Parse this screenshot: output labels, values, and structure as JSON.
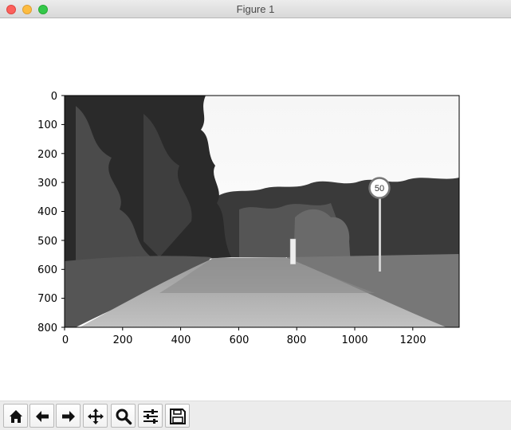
{
  "window": {
    "title": "Figure 1",
    "controls": [
      "close",
      "minimize",
      "maximize"
    ]
  },
  "axes": {
    "x_ticks": [
      "0",
      "200",
      "400",
      "600",
      "800",
      "1000",
      "1200"
    ],
    "y_ticks": [
      "0",
      "100",
      "200",
      "300",
      "400",
      "500",
      "600",
      "700",
      "800"
    ],
    "image_content": "grayscale photo",
    "sign_text": "50"
  },
  "toolbar": {
    "buttons": [
      {
        "name": "home-button",
        "icon": "home-icon"
      },
      {
        "name": "back-button",
        "icon": "arrow-left-icon"
      },
      {
        "name": "forward-button",
        "icon": "arrow-right-icon"
      },
      {
        "name": "pan-button",
        "icon": "move-icon"
      },
      {
        "name": "zoom-button",
        "icon": "magnifier-icon"
      },
      {
        "name": "configure-subplots-button",
        "icon": "sliders-icon"
      },
      {
        "name": "save-button",
        "icon": "floppy-disk-icon"
      }
    ]
  },
  "colors": {
    "titlebar": "#dedede",
    "toolbar": "#ececec",
    "close": "#fc605c",
    "minimize": "#fdbc40",
    "maximize": "#34c84a"
  }
}
